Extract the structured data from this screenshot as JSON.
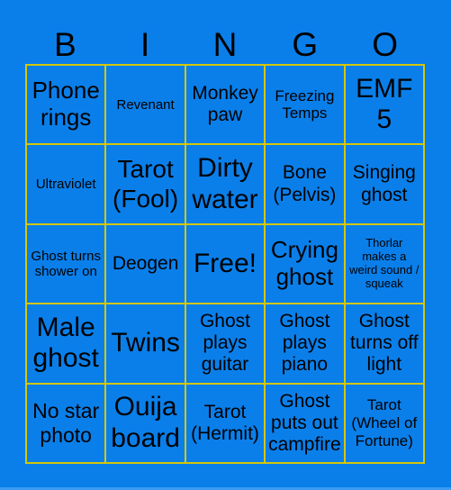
{
  "header": {
    "letters": [
      "B",
      "I",
      "N",
      "G",
      "O"
    ]
  },
  "colors": {
    "background": "#0a7fea",
    "grid_line": "#d4c60a",
    "text": "#000000"
  },
  "cells": [
    [
      "Phone rings",
      "Revenant",
      "Monkey paw",
      "Freezing Temps",
      "EMF 5"
    ],
    [
      "Ultraviolet",
      "Tarot (Fool)",
      "Dirty water",
      "Bone (Pelvis)",
      "Singing ghost"
    ],
    [
      "Ghost turns shower on",
      "Deogen",
      "Free!",
      "Crying ghost",
      "Thorlar makes a weird sound / squeak"
    ],
    [
      "Male ghost",
      "Twins",
      "Ghost plays guitar",
      "Ghost plays piano",
      "Ghost turns off light"
    ],
    [
      "No star photo",
      "Ouija board",
      "Tarot (Hermit)",
      "Ghost puts out campfire",
      "Tarot (Wheel of Fortune)"
    ]
  ]
}
